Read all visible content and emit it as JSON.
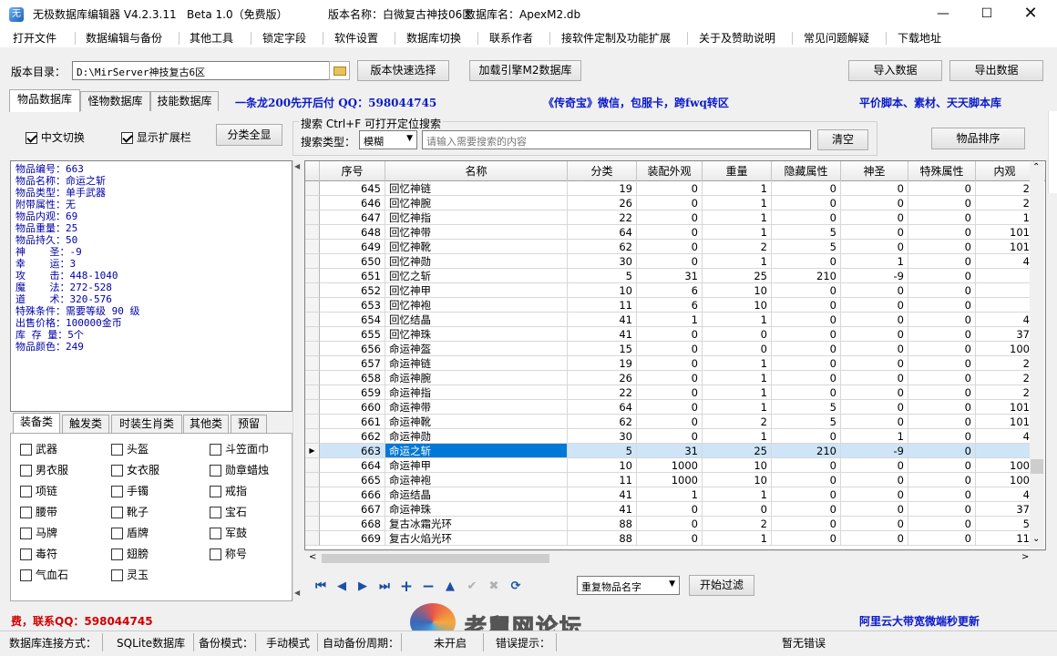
{
  "window": {
    "title": "无极数据库编辑器 V4.2.3.11",
    "edition": "Beta 1.0（免费版）",
    "version_name": "版本名称：白微复古神技06区",
    "db_name": "数据库名：ApexM2.db",
    "icon": "app-icon"
  },
  "menu": [
    "打开文件",
    "数据编辑与备份",
    "其他工具",
    "锁定字段",
    "软件设置",
    "数据库切换",
    "联系作者",
    "接软件定制及功能扩展",
    "关于及赞助说明",
    "常见问题解疑",
    "下载地址"
  ],
  "toolbar": {
    "dir_label": "版本目录：",
    "dir_value": "D:\\MirServer神技复古6区",
    "quick_select": "版本快速选择",
    "load_engine": "加载引擎M2数据库",
    "import": "导入数据",
    "export": "导出数据"
  },
  "tabs": [
    "物品数据库",
    "怪物数据库",
    "技能数据库"
  ],
  "ads": {
    "ad1": "一条龙200先开后付 QQ：598044745",
    "ad2": "《传奇宝》微信，包服卡，跨fwq转区",
    "ad3": "平价脚本、素材、天天脚本库",
    "ad4": "费，联系QQ：598044745",
    "ad5": "阿里云大带宽微端秒更新"
  },
  "options": {
    "cn_switch": "中文切换",
    "show_ext": "显示扩展栏",
    "all_categories": "分类全显",
    "search_caption": "搜索  Ctrl+F 可打开定位搜索",
    "search_type_label": "搜索类型：",
    "search_type_value": "模糊",
    "search_placeholder": "请输入需要搜索的内容",
    "clear": "清空",
    "sort": "物品排序"
  },
  "item_info": [
    "物品编号：663",
    "物品名称：命运之斩",
    "物品类型：单手武器",
    "附带属性：无",
    "物品内观：69",
    "物品重量：25",
    "物品持久：50",
    "神    圣：-9",
    "幸    运：3",
    "攻    击：448-1040",
    "魔    法：272-528",
    "道    术：320-576",
    "特殊条件：需要等级 90 级",
    "出售价格：100000金币",
    "库 存 量：5个",
    "物品颜色：249"
  ],
  "subtabs": [
    "装备类",
    "触发类",
    "时装生肖类",
    "其他类",
    "预留"
  ],
  "categories": [
    "武器",
    "头盔",
    "斗笠面巾",
    "男衣服",
    "女衣服",
    "勋章蜡烛",
    "项链",
    "手镯",
    "戒指",
    "腰带",
    "靴子",
    "宝石",
    "马牌",
    "盾牌",
    "军鼓",
    "毒符",
    "翅膀",
    "称号",
    "气血石",
    "灵玉"
  ],
  "grid": {
    "columns": [
      "序号",
      "名称",
      "分类",
      "装配外观",
      "重量",
      "隐藏属性",
      "神圣",
      "特殊属性",
      "内观"
    ],
    "rows": [
      [
        "645",
        "回忆神链",
        "19",
        "0",
        "1",
        "0",
        "0",
        "0",
        "2"
      ],
      [
        "646",
        "回忆神腕",
        "26",
        "0",
        "1",
        "0",
        "0",
        "0",
        "2"
      ],
      [
        "647",
        "回忆神指",
        "22",
        "0",
        "1",
        "0",
        "0",
        "0",
        "1"
      ],
      [
        "648",
        "回忆神带",
        "64",
        "0",
        "1",
        "5",
        "0",
        "0",
        "101"
      ],
      [
        "649",
        "回忆神靴",
        "62",
        "0",
        "2",
        "5",
        "0",
        "0",
        "101"
      ],
      [
        "650",
        "回忆神勋",
        "30",
        "0",
        "1",
        "0",
        "1",
        "0",
        "4"
      ],
      [
        "651",
        "回忆之斩",
        "5",
        "31",
        "25",
        "210",
        "-9",
        "0",
        ""
      ],
      [
        "652",
        "回忆神甲",
        "10",
        "6",
        "10",
        "0",
        "0",
        "0",
        ""
      ],
      [
        "653",
        "回忆神袍",
        "11",
        "6",
        "10",
        "0",
        "0",
        "0",
        ""
      ],
      [
        "654",
        "回忆结晶",
        "41",
        "1",
        "1",
        "0",
        "0",
        "0",
        "4"
      ],
      [
        "655",
        "回忆神珠",
        "41",
        "0",
        "0",
        "0",
        "0",
        "0",
        "37"
      ],
      [
        "656",
        "命运神盔",
        "15",
        "0",
        "0",
        "0",
        "0",
        "0",
        "100"
      ],
      [
        "657",
        "命运神链",
        "19",
        "0",
        "1",
        "0",
        "0",
        "0",
        "2"
      ],
      [
        "658",
        "命运神腕",
        "26",
        "0",
        "1",
        "0",
        "0",
        "0",
        "2"
      ],
      [
        "659",
        "命运神指",
        "22",
        "0",
        "1",
        "0",
        "0",
        "0",
        "2"
      ],
      [
        "660",
        "命运神带",
        "64",
        "0",
        "1",
        "5",
        "0",
        "0",
        "101"
      ],
      [
        "661",
        "命运神靴",
        "62",
        "0",
        "2",
        "5",
        "0",
        "0",
        "101"
      ],
      [
        "662",
        "命运神勋",
        "30",
        "0",
        "1",
        "0",
        "1",
        "0",
        "4"
      ],
      [
        "663",
        "命运之斩",
        "5",
        "31",
        "25",
        "210",
        "-9",
        "0",
        ""
      ],
      [
        "664",
        "命运神甲",
        "10",
        "1000",
        "10",
        "0",
        "0",
        "0",
        "100"
      ],
      [
        "665",
        "命运神袍",
        "11",
        "1000",
        "10",
        "0",
        "0",
        "0",
        "100"
      ],
      [
        "666",
        "命运结晶",
        "41",
        "1",
        "1",
        "0",
        "0",
        "0",
        "4"
      ],
      [
        "667",
        "命运神珠",
        "41",
        "0",
        "0",
        "0",
        "0",
        "0",
        "37"
      ],
      [
        "668",
        "复古冰霜光环",
        "88",
        "0",
        "2",
        "0",
        "0",
        "0",
        "5"
      ],
      [
        "669",
        "复古火焰光环",
        "88",
        "0",
        "1",
        "0",
        "0",
        "0",
        "11"
      ]
    ],
    "selected_row": "663"
  },
  "bottom": {
    "filter_value": "重复物品名字",
    "start_filter": "开始过滤"
  },
  "status": {
    "conn_label": "数据库连接方式：",
    "conn_value": "SQLite数据库",
    "backup_label": "备份模式：",
    "backup_value": "手动模式",
    "auto_label": "自动备份周期：",
    "auto_value": "未开启",
    "error_label": "错误提示：",
    "error_value": "暂无错误"
  },
  "watermark": "老舅网论坛"
}
